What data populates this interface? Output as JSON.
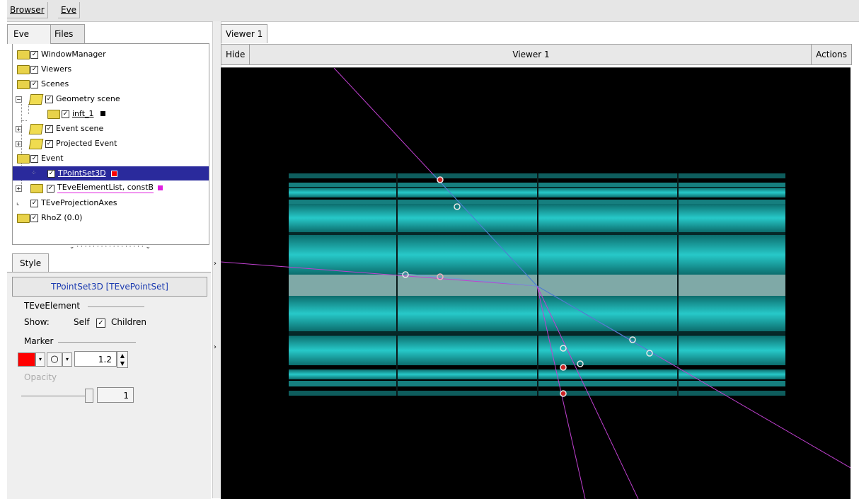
{
  "menubar": {
    "browser": "Browser",
    "eve": "Eve"
  },
  "left_tabs": [
    "Eve",
    "Files"
  ],
  "tree": {
    "items": [
      {
        "label": "WindowManager"
      },
      {
        "label": "Viewers"
      },
      {
        "label": "Scenes"
      },
      {
        "label": "Geometry scene"
      },
      {
        "label": "inft_1"
      },
      {
        "label": "Event scene"
      },
      {
        "label": "Projected Event"
      },
      {
        "label": "Event"
      },
      {
        "label": "TPointSet3D"
      },
      {
        "label": "TEveElementList, constB"
      },
      {
        "label": "TEveProjectionAxes"
      },
      {
        "label": "RhoZ (0.0)"
      }
    ],
    "colors": {
      "inft_1": "#000000",
      "TPointSet3D": "#ff0000",
      "constB": "#e020e0"
    }
  },
  "style_panel": {
    "tab": "Style",
    "title": "TPointSet3D [TEvePointSet]",
    "group_element": "TEveElement",
    "show_label": "Show:",
    "self_label": "Self",
    "children_label": "Children",
    "group_marker": "Marker",
    "marker_color": "#ff0000",
    "marker_size": "1.2",
    "opacity_label": "Opacity",
    "opacity_value": "1"
  },
  "viewer": {
    "tab": "Viewer 1",
    "hide": "Hide",
    "title": "Viewer 1",
    "actions": "Actions"
  }
}
